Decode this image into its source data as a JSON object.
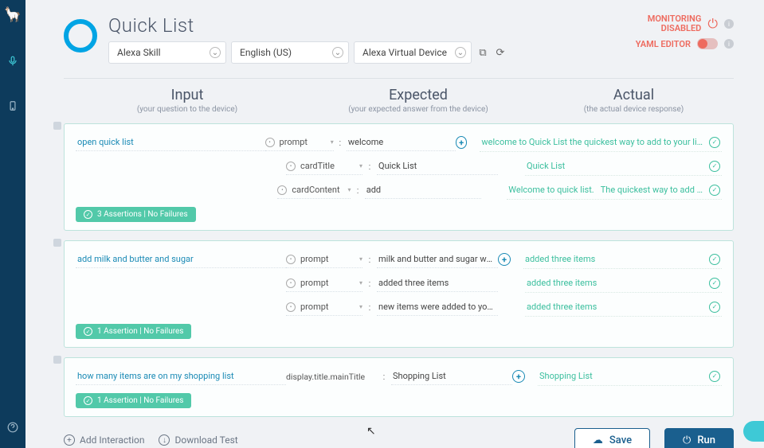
{
  "header": {
    "title": "Quick List",
    "platform": "Alexa Skill",
    "locale": "English (US)",
    "device": "Alexa Virtual Device",
    "monitoring_line1": "MONITORING",
    "monitoring_line2": "DISABLED",
    "yaml_label": "YAML EDITOR"
  },
  "columns": {
    "input_title": "Input",
    "input_sub": "(your question to the device)",
    "expected_title": "Expected",
    "expected_sub": "(your expected answer from the device)",
    "actual_title": "Actual",
    "actual_sub": "(the actual device response)"
  },
  "blocks": [
    {
      "input": "open quick list",
      "badge": "3 Assertions | No Failures",
      "rows": [
        {
          "attr": "prompt",
          "exp": "welcome",
          "plus": true,
          "act": "welcome to Quick List the quickest way to add to your li…"
        },
        {
          "attr": "cardTitle",
          "exp": "Quick List",
          "plus": false,
          "act": "Quick List"
        },
        {
          "attr": "cardContent",
          "exp": "add",
          "plus": false,
          "act": "Welcome to quick list.",
          "act2": "The quickest way to add …"
        }
      ]
    },
    {
      "input": "add milk and butter and sugar",
      "badge": "1 Assertion | No Failures",
      "rows": [
        {
          "attr": "prompt",
          "exp": "milk and butter and sugar were add…",
          "plus": true,
          "act": "added three items"
        },
        {
          "attr": "prompt",
          "exp": "added three items",
          "plus": false,
          "act": "added three items"
        },
        {
          "attr": "prompt",
          "exp": "new items were added to your list",
          "plus": false,
          "act": "added three items"
        }
      ]
    },
    {
      "input": "how many items are on my shopping list",
      "badge": "1 Assertion | No Failures",
      "rows": [
        {
          "attr_wide": "display.title.mainTitle",
          "exp": "Shopping List",
          "plus": true,
          "act": "Shopping List"
        }
      ]
    }
  ],
  "footer": {
    "add": "Add Interaction",
    "download": "Download Test",
    "save": "Save",
    "run": "Run"
  }
}
